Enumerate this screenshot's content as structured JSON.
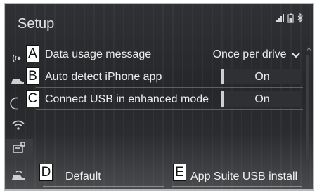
{
  "screen": {
    "title": "Setup"
  },
  "status_icons": [
    "signal-icon",
    "battery-icon",
    "bluetooth-icon"
  ],
  "settings": [
    {
      "callout": "A",
      "label": "Data usage message",
      "value": "Once per drive",
      "control": "dropdown"
    },
    {
      "callout": "B",
      "label": "Auto detect iPhone app",
      "value": "On",
      "control": "toggle"
    },
    {
      "callout": "C",
      "label": "Connect USB in enhanced mode",
      "value": "On",
      "control": "toggle"
    }
  ],
  "sidebar_icons": [
    "connectivity-icon",
    "vehicle-icon",
    "phone-icon",
    "wifi-icon",
    "apps-icon",
    "car-settings-icon"
  ],
  "buttons": {
    "default": {
      "callout": "D",
      "label": "Default"
    },
    "app_suite": {
      "callout": "E",
      "label": "App Suite USB install"
    }
  },
  "colors": {
    "background": "#2b2d30",
    "text": "#ececec",
    "toggle_on": "#cfcfcf"
  }
}
